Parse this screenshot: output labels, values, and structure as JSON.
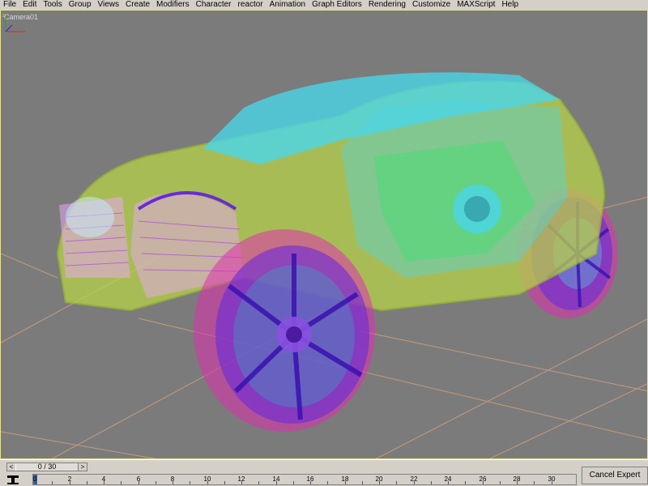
{
  "menubar": {
    "items": [
      {
        "label": "File"
      },
      {
        "label": "Edit"
      },
      {
        "label": "Tools"
      },
      {
        "label": "Group"
      },
      {
        "label": "Views"
      },
      {
        "label": "Create"
      },
      {
        "label": "Modifiers"
      },
      {
        "label": "Character"
      },
      {
        "label": "reactor"
      },
      {
        "label": "Animation"
      },
      {
        "label": "Graph Editors"
      },
      {
        "label": "Rendering"
      },
      {
        "label": "Customize"
      },
      {
        "label": "MAXScript"
      },
      {
        "label": "Help"
      }
    ]
  },
  "viewport": {
    "label": "Camera01",
    "background": "#7b7b7b",
    "border_color": "#e8e48c",
    "grid_color": "#d9a37d"
  },
  "time_slider": {
    "frame_display": "0 / 30",
    "left_arrow": "<",
    "right_arrow": ">"
  },
  "trackbar": {
    "ticks": [
      "0",
      "2",
      "4",
      "6",
      "8",
      "10",
      "12",
      "14",
      "16",
      "18",
      "20",
      "22",
      "24",
      "26",
      "28",
      "30"
    ]
  },
  "status": {
    "cancel_expert": "Cancel Expert Mode"
  },
  "wire_colors": {
    "body": "#b8d24a",
    "glass": "#4ad6e8",
    "wheel": "#6a2ad8",
    "wheel_accent": "#e030b0",
    "interior": "#40e070",
    "grille": "#e8a8f0"
  }
}
